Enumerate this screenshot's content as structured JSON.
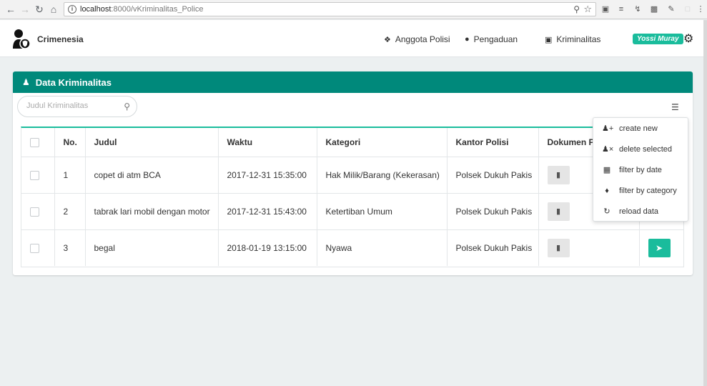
{
  "browser": {
    "url_host": "localhost",
    "url_path": ":8000/vKriminalitas_Police",
    "icons": [
      "back-icon",
      "forward-icon",
      "reload-icon",
      "home-icon",
      "info-icon",
      "zoom-icon",
      "star-icon"
    ]
  },
  "navbar": {
    "brand": "Crimenesia",
    "links": [
      {
        "label": "Anggota Polisi",
        "icon": "users-icon"
      },
      {
        "label": "Pengaduan",
        "icon": "comment-icon"
      },
      {
        "label": "Kriminalitas",
        "icon": "lock-icon"
      }
    ],
    "user": "Yossi Muray"
  },
  "panel": {
    "title": "Data Kriminalitas",
    "search_placeholder": "Judul Kriminalitas"
  },
  "table": {
    "columns": [
      "No.",
      "Judul",
      "Waktu",
      "Kategori",
      "Kantor Polisi",
      "Dokumen Pe"
    ],
    "rows": [
      {
        "no": "1",
        "judul": "copet di atm BCA",
        "waktu": "2017-12-31 15:35:00",
        "kategori": "Hak Milik/Barang (Kekerasan)",
        "kantor": "Polsek Dukuh Pakis"
      },
      {
        "no": "2",
        "judul": "tabrak lari mobil dengan motor",
        "waktu": "2017-12-31 15:43:00",
        "kategori": "Ketertiban Umum",
        "kantor": "Polsek Dukuh Pakis"
      },
      {
        "no": "3",
        "judul": "begal",
        "waktu": "2018-01-19 13:15:00",
        "kategori": "Nyawa",
        "kantor": "Polsek Dukuh Pakis"
      }
    ]
  },
  "menu": {
    "items": [
      {
        "label": "create new",
        "icon": "user-plus-icon"
      },
      {
        "label": "delete selected",
        "icon": "user-times-icon"
      },
      {
        "label": "filter by date",
        "icon": "calendar-icon"
      },
      {
        "label": "filter by category",
        "icon": "tag-icon"
      },
      {
        "label": "reload data",
        "icon": "refresh-icon"
      }
    ]
  },
  "colors": {
    "header_teal": "#00897b",
    "accent": "#1abc9c",
    "background": "#ecf0f1"
  }
}
